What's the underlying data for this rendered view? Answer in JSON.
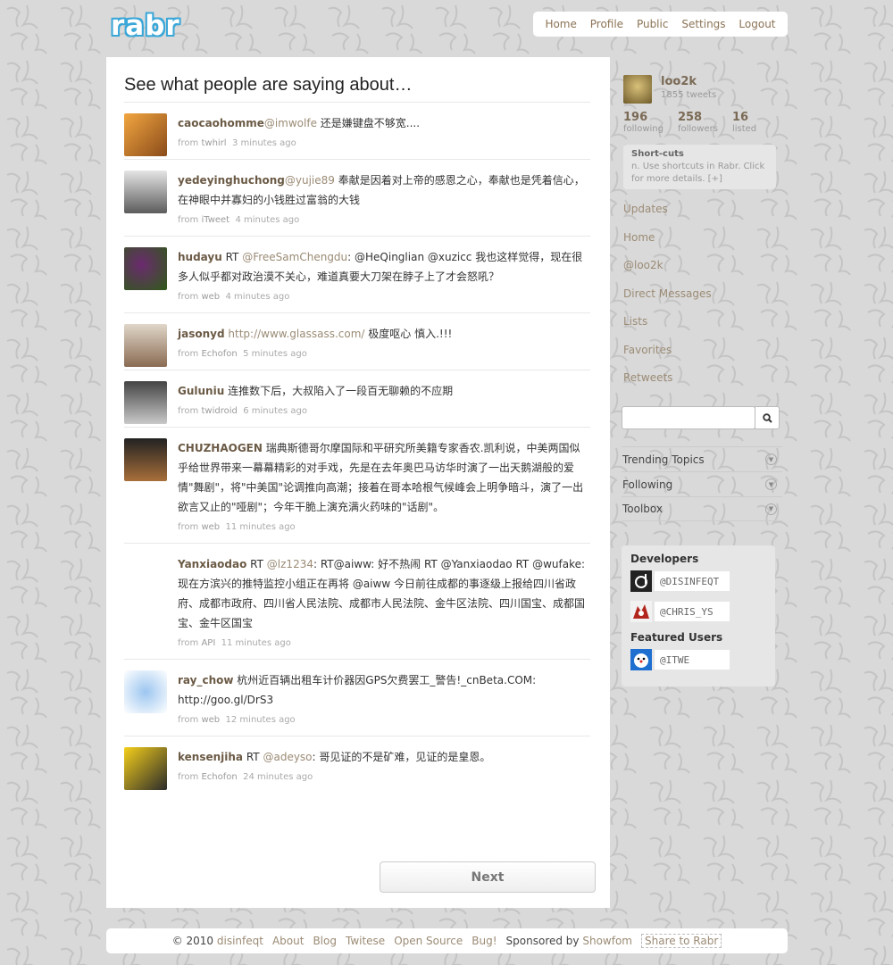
{
  "logo": {
    "text": "rabr"
  },
  "topnav": {
    "home": "Home",
    "profile": "Profile",
    "public": "Public",
    "settings": "Settings",
    "logout": "Logout"
  },
  "main": {
    "heading": "See what people are saying about…",
    "tweets": [
      {
        "user": "caocaohomme",
        "pre": "",
        "mention": "@imwolfe",
        "text": " 还是嫌键盘不够宽....",
        "source": "twhirl",
        "time": "3 minutes ago"
      },
      {
        "user": "yedeyinghuchong",
        "pre": "",
        "mention": "@yujie89",
        "text": " 奉献是因着对上帝的感恩之心，奉献也是凭着信心，在神眼中并寡妇的小钱胜过富翁的大钱",
        "source": "iTweet",
        "time": "4 minutes ago"
      },
      {
        "user": "hudayu",
        "pre": " RT ",
        "mention": "@FreeSamChengdu",
        "text": ": @HeQinglian @xuzicc 我也这样觉得，现在很多人似乎都对政治漠不关心，难道真要大刀架在脖子上了才会怒吼？",
        "source": "web",
        "time": "4 minutes ago"
      },
      {
        "user": "jasonyd",
        "pre": " ",
        "mention": "http://www.glassass.com/",
        "text": " 极度呕心 慎入.!!!",
        "source": "Echofon",
        "time": "5 minutes ago"
      },
      {
        "user": "Guluniu",
        "pre": "",
        "mention": "",
        "text": " 连推数下后，大叔陷入了一段百无聊赖的不应期",
        "source": "twidroid",
        "time": "6 minutes ago"
      },
      {
        "user": "CHUZHAOGEN",
        "pre": "",
        "mention": "",
        "text": " 瑞典斯德哥尔摩国际和平研究所美籍专家香农.凯利说，中美两国似乎给世界带来一幕幕精彩的对手戏，先是在去年奥巴马访华时演了一出天鹅湖般的爱情\"舞剧\"，将\"中美国\"论调推向高潮；接着在哥本哈根气候峰会上明争暗斗，演了一出欲言又止的\"哑剧\"；今年干脆上演充满火药味的\"话剧\"。",
        "source": "web",
        "time": "11 minutes ago"
      },
      {
        "user": "Yanxiaodao",
        "pre": " RT ",
        "mention": "@lz1234",
        "text": ": RT@aiww: 好不热闹 RT @Yanxiaodao RT @wufake: 现在方滨兴的推特监控小组正在再将 @aiww 今日前往成都的事逐级上报给四川省政府、成都市政府、四川省人民法院、成都市人民法院、金牛区法院、四川国宝、成都国宝、金牛区国宝",
        "source": "API",
        "time": "11 minutes ago"
      },
      {
        "user": "ray_chow",
        "pre": "",
        "mention": "",
        "text": " 杭州近百辆出租车计价器因GPS欠费罢工_警告!_cnBeta.COM: http://goo.gl/DrS3",
        "source": "web",
        "time": "12 minutes ago"
      },
      {
        "user": "kensenjiha",
        "pre": " RT ",
        "mention": "@adeyso",
        "text": ": 哥见证的不是矿难，见证的是皇恩。",
        "source": "Echofon",
        "time": "24 minutes ago"
      }
    ],
    "from_label": "from",
    "next_label": "Next"
  },
  "sidebar": {
    "profile_name": "loo2k",
    "tweet_count": "1855 tweets",
    "stats": [
      {
        "num": "196",
        "label": "following"
      },
      {
        "num": "258",
        "label": "followers"
      },
      {
        "num": "16",
        "label": "listed"
      }
    ],
    "shortcuts_title": "Short-cuts",
    "shortcuts_text": "n. Use shortcuts in Rabr. Click for more details. [+]",
    "nav": [
      "Updates",
      "Home",
      "@loo2k",
      "Direct Messages",
      "Lists",
      "Favorites",
      "Retweets"
    ],
    "search_placeholder": "",
    "accordion": [
      "Trending Topics",
      "Following",
      "Toolbox"
    ],
    "developers_title": "Developers",
    "developers": [
      "@DISINFEQT",
      "@CHRIS_YS"
    ],
    "featured_title": "Featured Users",
    "featured": [
      "@ITWE"
    ]
  },
  "footer": {
    "copy": "© 2010",
    "author": "disinfeqt",
    "links": [
      "About",
      "Blog",
      "Twitese",
      "Open Source",
      "Bug!"
    ],
    "sponsored": "Sponsored by",
    "sponsor": "Showfom",
    "share": "Share to Rabr"
  }
}
